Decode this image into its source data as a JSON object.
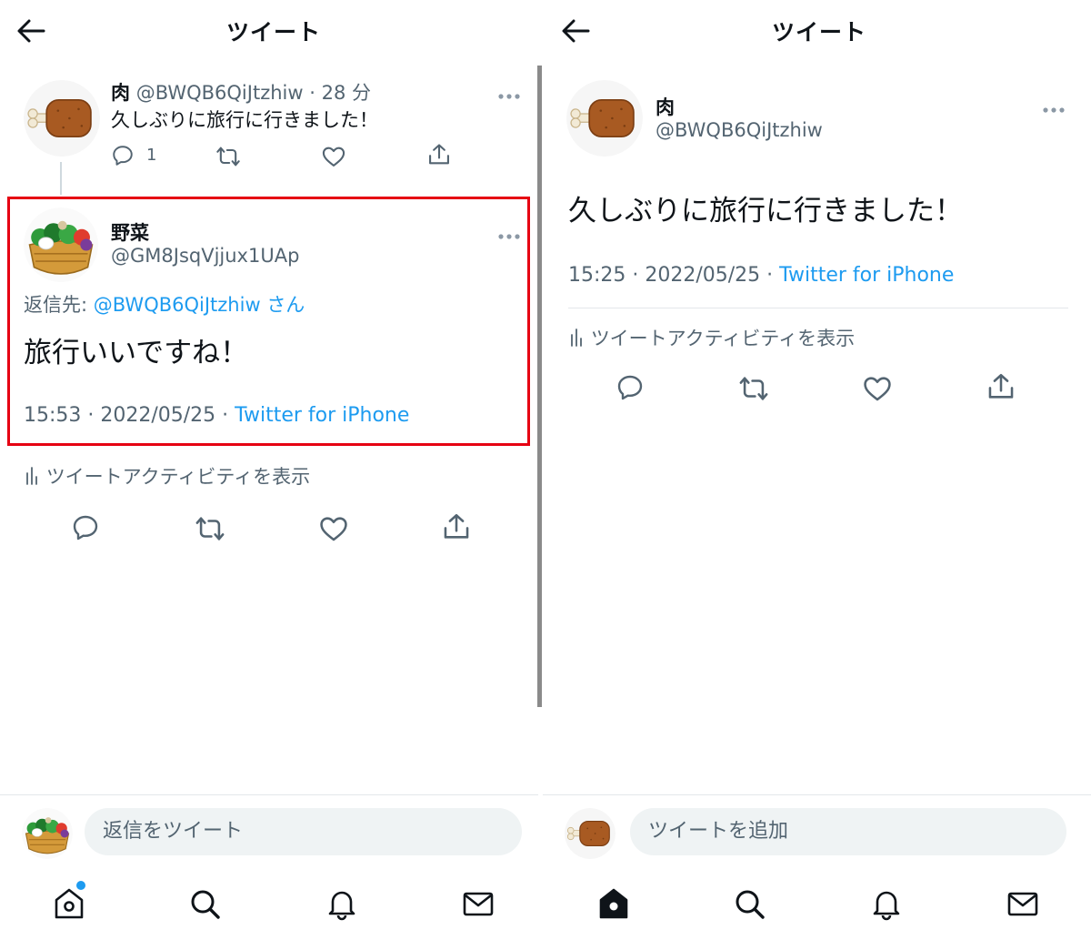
{
  "left": {
    "header_title": "ツイート",
    "parent_tweet": {
      "name": "肉",
      "handle": "@BWQB6QiJtzhiw",
      "time": "· 28 分",
      "text": "久しぶりに旅行に行きました！",
      "reply_count": "1"
    },
    "reply_tweet": {
      "name": "野菜",
      "handle": "@GM8JsqVjjux1UAp",
      "reply_to_label": "返信先:",
      "reply_to_handle": "@BWQB6QiJtzhiw",
      "reply_to_suffix": "さん",
      "text": "旅行いいですね！",
      "timestamp": "15:53 · 2022/05/25 ·",
      "source": "Twitter for iPhone"
    },
    "activity_label": "ツイートアクティビティを表示",
    "reply_placeholder": "返信をツイート"
  },
  "right": {
    "header_title": "ツイート",
    "tweet": {
      "name": "肉",
      "handle": "@BWQB6QiJtzhiw",
      "text": "久しぶりに旅行に行きました！",
      "timestamp": "15:25 · 2022/05/25 ·",
      "source": "Twitter for iPhone"
    },
    "activity_label": "ツイートアクティビティを表示",
    "reply_placeholder": "ツイートを追加"
  },
  "colors": {
    "accent": "#1d9bf0",
    "highlight_border": "#e60012",
    "meat": "#a0521d"
  },
  "nav_icons": [
    "home-icon",
    "search-icon",
    "notifications-icon",
    "messages-icon"
  ]
}
